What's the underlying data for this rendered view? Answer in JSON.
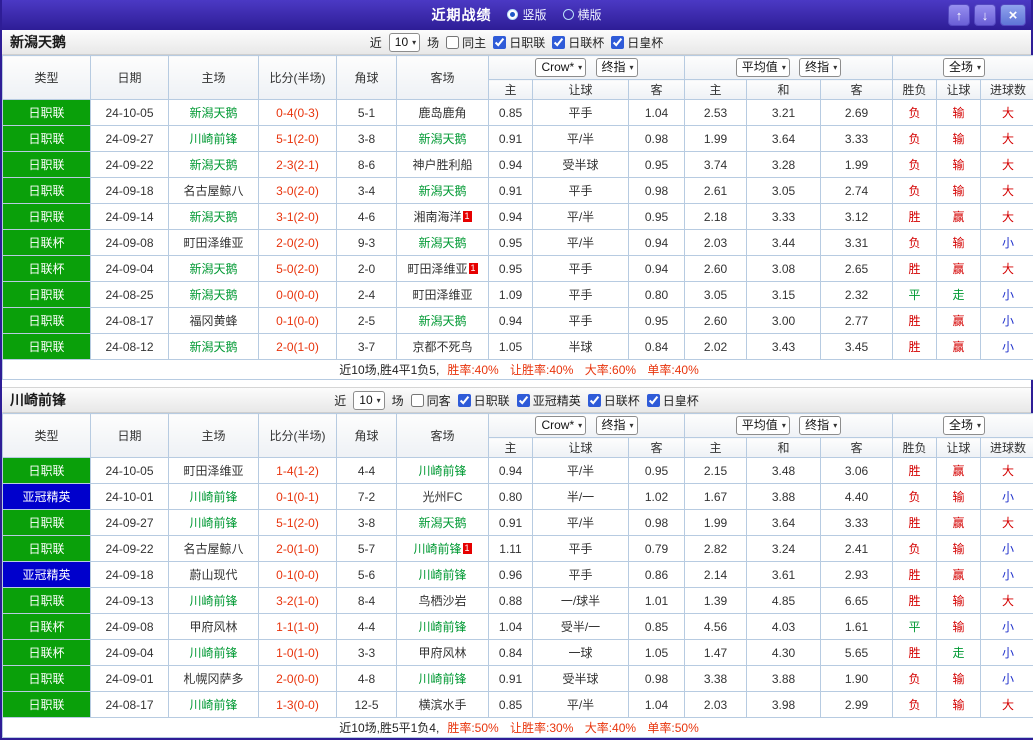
{
  "titlebar": {
    "title": "近期战绩",
    "modes": [
      {
        "label": "竖版",
        "selected": true
      },
      {
        "label": "横版",
        "selected": false
      }
    ],
    "buttons": {
      "up": "↑",
      "down": "↓",
      "close": "×"
    }
  },
  "colors": {
    "league_green": "#0aa00a",
    "league_blue": "#0000cc",
    "team_green": "#009933",
    "score_red": "#e8340c",
    "res_red": "#d40000",
    "res_blue": "#2233cc",
    "res_green": "#009933"
  },
  "filter_labels": {
    "recent_pre": "近",
    "recent_post": "场"
  },
  "table_header": {
    "type": "类型",
    "date": "日期",
    "home": "主场",
    "score": "比分(半场)",
    "corner": "角球",
    "away": "客场",
    "group1_select1": "Crow*",
    "group1_select2": "终指",
    "group2_select1": "平均值",
    "group2_select2": "终指",
    "group3_select1": "全场",
    "sub": [
      "主",
      "让球",
      "客",
      "主",
      "和",
      "客",
      "胜负",
      "让球",
      "进球数"
    ]
  },
  "sections": [
    {
      "team": "新潟天鹅",
      "filter": {
        "recent": "10",
        "same": {
          "label": "同主",
          "checked": false
        },
        "leagues": [
          {
            "label": "日职联",
            "checked": true
          },
          {
            "label": "日联杯",
            "checked": true
          },
          {
            "label": "日皇杯",
            "checked": true
          }
        ]
      },
      "rows": [
        {
          "league": "日职联",
          "lc": "green",
          "date": "24-10-05",
          "home": "新潟天鹅",
          "hg": true,
          "hb": "",
          "score": "0-4(0-3)",
          "corner": "5-1",
          "away": "鹿岛鹿角",
          "ag": false,
          "ab": "",
          "odds": [
            "0.85",
            "平手",
            "1.04",
            "2.53",
            "3.21",
            "2.69"
          ],
          "res": [
            [
              "负",
              "red"
            ],
            [
              "输",
              "red"
            ],
            [
              "大",
              "red"
            ]
          ]
        },
        {
          "league": "日职联",
          "lc": "green",
          "date": "24-09-27",
          "home": "川崎前锋",
          "hg": true,
          "hb": "",
          "score": "5-1(2-0)",
          "corner": "3-8",
          "away": "新潟天鹅",
          "ag": true,
          "ab": "",
          "odds": [
            "0.91",
            "平/半",
            "0.98",
            "1.99",
            "3.64",
            "3.33"
          ],
          "res": [
            [
              "负",
              "red"
            ],
            [
              "输",
              "red"
            ],
            [
              "大",
              "red"
            ]
          ]
        },
        {
          "league": "日职联",
          "lc": "green",
          "date": "24-09-22",
          "home": "新潟天鹅",
          "hg": true,
          "hb": "",
          "score": "2-3(2-1)",
          "corner": "8-6",
          "away": "神户胜利船",
          "ag": false,
          "ab": "",
          "odds": [
            "0.94",
            "受半球",
            "0.95",
            "3.74",
            "3.28",
            "1.99"
          ],
          "res": [
            [
              "负",
              "red"
            ],
            [
              "输",
              "red"
            ],
            [
              "大",
              "red"
            ]
          ]
        },
        {
          "league": "日职联",
          "lc": "green",
          "date": "24-09-18",
          "home": "名古屋鲸八",
          "hg": false,
          "hb": "",
          "score": "3-0(2-0)",
          "corner": "3-4",
          "away": "新潟天鹅",
          "ag": true,
          "ab": "",
          "odds": [
            "0.91",
            "平手",
            "0.98",
            "2.61",
            "3.05",
            "2.74"
          ],
          "res": [
            [
              "负",
              "red"
            ],
            [
              "输",
              "red"
            ],
            [
              "大",
              "red"
            ]
          ]
        },
        {
          "league": "日职联",
          "lc": "green",
          "date": "24-09-14",
          "home": "新潟天鹅",
          "hg": true,
          "hb": "",
          "score": "3-1(2-0)",
          "corner": "4-6",
          "away": "湘南海洋",
          "ag": false,
          "ab": "1",
          "odds": [
            "0.94",
            "平/半",
            "0.95",
            "2.18",
            "3.33",
            "3.12"
          ],
          "res": [
            [
              "胜",
              "red"
            ],
            [
              "赢",
              "red"
            ],
            [
              "大",
              "red"
            ]
          ]
        },
        {
          "league": "日联杯",
          "lc": "green",
          "date": "24-09-08",
          "home": "町田泽维亚",
          "hg": false,
          "hb": "",
          "score": "2-0(2-0)",
          "corner": "9-3",
          "away": "新潟天鹅",
          "ag": true,
          "ab": "",
          "odds": [
            "0.95",
            "平/半",
            "0.94",
            "2.03",
            "3.44",
            "3.31"
          ],
          "res": [
            [
              "负",
              "red"
            ],
            [
              "输",
              "red"
            ],
            [
              "小",
              "blue"
            ]
          ]
        },
        {
          "league": "日联杯",
          "lc": "green",
          "date": "24-09-04",
          "home": "新潟天鹅",
          "hg": true,
          "hb": "",
          "score": "5-0(2-0)",
          "corner": "2-0",
          "away": "町田泽维亚",
          "ag": false,
          "ab": "1",
          "odds": [
            "0.95",
            "平手",
            "0.94",
            "2.60",
            "3.08",
            "2.65"
          ],
          "res": [
            [
              "胜",
              "red"
            ],
            [
              "赢",
              "red"
            ],
            [
              "大",
              "red"
            ]
          ]
        },
        {
          "league": "日职联",
          "lc": "green",
          "date": "24-08-25",
          "home": "新潟天鹅",
          "hg": true,
          "hb": "",
          "score": "0-0(0-0)",
          "corner": "2-4",
          "away": "町田泽维亚",
          "ag": false,
          "ab": "",
          "odds": [
            "1.09",
            "平手",
            "0.80",
            "3.05",
            "3.15",
            "2.32"
          ],
          "res": [
            [
              "平",
              "green"
            ],
            [
              "走",
              "green"
            ],
            [
              "小",
              "blue"
            ]
          ]
        },
        {
          "league": "日职联",
          "lc": "green",
          "date": "24-08-17",
          "home": "福冈黄蜂",
          "hg": false,
          "hb": "",
          "score": "0-1(0-0)",
          "corner": "2-5",
          "away": "新潟天鹅",
          "ag": true,
          "ab": "",
          "odds": [
            "0.94",
            "平手",
            "0.95",
            "2.60",
            "3.00",
            "2.77"
          ],
          "res": [
            [
              "胜",
              "red"
            ],
            [
              "赢",
              "red"
            ],
            [
              "小",
              "blue"
            ]
          ]
        },
        {
          "league": "日职联",
          "lc": "green",
          "date": "24-08-12",
          "home": "新潟天鹅",
          "hg": true,
          "hb": "",
          "score": "2-0(1-0)",
          "corner": "3-7",
          "away": "京都不死鸟",
          "ag": false,
          "ab": "",
          "odds": [
            "1.05",
            "半球",
            "0.84",
            "2.02",
            "3.43",
            "3.45"
          ],
          "res": [
            [
              "胜",
              "red"
            ],
            [
              "赢",
              "red"
            ],
            [
              "小",
              "blue"
            ]
          ]
        }
      ],
      "summary": {
        "prefix": "近10场,胜4平1负5,",
        "stats": "胜率:40% 让胜率:40% 大率:60% 单率:40%"
      }
    },
    {
      "team": "川崎前锋",
      "filter": {
        "recent": "10",
        "same": {
          "label": "同客",
          "checked": false
        },
        "leagues": [
          {
            "label": "日职联",
            "checked": true
          },
          {
            "label": "亚冠精英",
            "checked": true
          },
          {
            "label": "日联杯",
            "checked": true
          },
          {
            "label": "日皇杯",
            "checked": true
          }
        ]
      },
      "rows": [
        {
          "league": "日职联",
          "lc": "green",
          "date": "24-10-05",
          "home": "町田泽维亚",
          "hg": false,
          "hb": "",
          "score": "1-4(1-2)",
          "corner": "4-4",
          "away": "川崎前锋",
          "ag": true,
          "ab": "",
          "odds": [
            "0.94",
            "平/半",
            "0.95",
            "2.15",
            "3.48",
            "3.06"
          ],
          "res": [
            [
              "胜",
              "red"
            ],
            [
              "赢",
              "red"
            ],
            [
              "大",
              "red"
            ]
          ]
        },
        {
          "league": "亚冠精英",
          "lc": "blue",
          "date": "24-10-01",
          "home": "川崎前锋",
          "hg": true,
          "hb": "",
          "score": "0-1(0-1)",
          "corner": "7-2",
          "away": "光州FC",
          "ag": false,
          "ab": "",
          "odds": [
            "0.80",
            "半/一",
            "1.02",
            "1.67",
            "3.88",
            "4.40"
          ],
          "res": [
            [
              "负",
              "red"
            ],
            [
              "输",
              "red"
            ],
            [
              "小",
              "blue"
            ]
          ]
        },
        {
          "league": "日职联",
          "lc": "green",
          "date": "24-09-27",
          "home": "川崎前锋",
          "hg": true,
          "hb": "",
          "score": "5-1(2-0)",
          "corner": "3-8",
          "away": "新潟天鹅",
          "ag": true,
          "ab": "",
          "odds": [
            "0.91",
            "平/半",
            "0.98",
            "1.99",
            "3.64",
            "3.33"
          ],
          "res": [
            [
              "胜",
              "red"
            ],
            [
              "赢",
              "red"
            ],
            [
              "大",
              "red"
            ]
          ]
        },
        {
          "league": "日职联",
          "lc": "green",
          "date": "24-09-22",
          "home": "名古屋鲸八",
          "hg": false,
          "hb": "",
          "score": "2-0(1-0)",
          "corner": "5-7",
          "away": "川崎前锋",
          "ag": true,
          "ab": "1",
          "odds": [
            "1.11",
            "平手",
            "0.79",
            "2.82",
            "3.24",
            "2.41"
          ],
          "res": [
            [
              "负",
              "red"
            ],
            [
              "输",
              "red"
            ],
            [
              "小",
              "blue"
            ]
          ]
        },
        {
          "league": "亚冠精英",
          "lc": "blue",
          "date": "24-09-18",
          "home": "蔚山现代",
          "hg": false,
          "hb": "",
          "score": "0-1(0-0)",
          "corner": "5-6",
          "away": "川崎前锋",
          "ag": true,
          "ab": "",
          "odds": [
            "0.96",
            "平手",
            "0.86",
            "2.14",
            "3.61",
            "2.93"
          ],
          "res": [
            [
              "胜",
              "red"
            ],
            [
              "赢",
              "red"
            ],
            [
              "小",
              "blue"
            ]
          ]
        },
        {
          "league": "日职联",
          "lc": "green",
          "date": "24-09-13",
          "home": "川崎前锋",
          "hg": true,
          "hb": "",
          "score": "3-2(1-0)",
          "corner": "8-4",
          "away": "鸟栖沙岩",
          "ag": false,
          "ab": "",
          "odds": [
            "0.88",
            "一/球半",
            "1.01",
            "1.39",
            "4.85",
            "6.65"
          ],
          "res": [
            [
              "胜",
              "red"
            ],
            [
              "输",
              "red"
            ],
            [
              "大",
              "red"
            ]
          ]
        },
        {
          "league": "日联杯",
          "lc": "green",
          "date": "24-09-08",
          "home": "甲府风林",
          "hg": false,
          "hb": "",
          "score": "1-1(1-0)",
          "corner": "4-4",
          "away": "川崎前锋",
          "ag": true,
          "ab": "",
          "odds": [
            "1.04",
            "受半/一",
            "0.85",
            "4.56",
            "4.03",
            "1.61"
          ],
          "res": [
            [
              "平",
              "green"
            ],
            [
              "输",
              "red"
            ],
            [
              "小",
              "blue"
            ]
          ]
        },
        {
          "league": "日联杯",
          "lc": "green",
          "date": "24-09-04",
          "home": "川崎前锋",
          "hg": true,
          "hb": "",
          "score": "1-0(1-0)",
          "corner": "3-3",
          "away": "甲府风林",
          "ag": false,
          "ab": "",
          "odds": [
            "0.84",
            "一球",
            "1.05",
            "1.47",
            "4.30",
            "5.65"
          ],
          "res": [
            [
              "胜",
              "red"
            ],
            [
              "走",
              "green"
            ],
            [
              "小",
              "blue"
            ]
          ]
        },
        {
          "league": "日职联",
          "lc": "green",
          "date": "24-09-01",
          "home": "札幌冈萨多",
          "hg": false,
          "hb": "",
          "score": "2-0(0-0)",
          "corner": "4-8",
          "away": "川崎前锋",
          "ag": true,
          "ab": "",
          "odds": [
            "0.91",
            "受半球",
            "0.98",
            "3.38",
            "3.88",
            "1.90"
          ],
          "res": [
            [
              "负",
              "red"
            ],
            [
              "输",
              "red"
            ],
            [
              "小",
              "blue"
            ]
          ]
        },
        {
          "league": "日职联",
          "lc": "green",
          "date": "24-08-17",
          "home": "川崎前锋",
          "hg": true,
          "hb": "",
          "score": "1-3(0-0)",
          "corner": "12-5",
          "away": "横滨水手",
          "ag": false,
          "ab": "",
          "odds": [
            "0.85",
            "平/半",
            "1.04",
            "2.03",
            "3.98",
            "2.99"
          ],
          "res": [
            [
              "负",
              "red"
            ],
            [
              "输",
              "red"
            ],
            [
              "大",
              "red"
            ]
          ]
        }
      ],
      "summary": {
        "prefix": "近10场,胜5平1负4,",
        "stats": "胜率:50% 让胜率:30% 大率:40% 单率:50%"
      }
    }
  ]
}
